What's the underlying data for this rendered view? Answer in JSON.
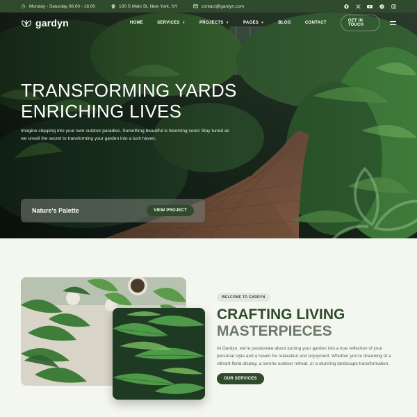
{
  "topbar": {
    "hours": "Monday - Saturday 08.00 - 18.00",
    "address": "100 S Main St, New York, NY",
    "email": "contact@gardyn.com",
    "social_icons": [
      "facebook-icon",
      "x-icon",
      "youtube-icon",
      "pinterest-icon",
      "instagram-icon"
    ]
  },
  "nav": {
    "logo_text": "gardyn",
    "items": [
      {
        "label": "HOME",
        "has_dropdown": false
      },
      {
        "label": "SERVICES",
        "has_dropdown": true
      },
      {
        "label": "PROJECTS",
        "has_dropdown": true
      },
      {
        "label": "PAGES",
        "has_dropdown": true
      },
      {
        "label": "BLOG",
        "has_dropdown": false
      },
      {
        "label": "CONTACT",
        "has_dropdown": false
      }
    ],
    "cta_label": "GET IN TOUCH"
  },
  "hero": {
    "title_line1": "TRANSFORMING YARDS",
    "title_line2": "ENRICHING LIVES",
    "description": "Imagine stepping into your own outdoor paradise. Something beautiful is blooming soon! Stay tuned as we unveil the secret to transforming your garden into a lush haven.",
    "project_name": "Nature's Palette",
    "project_button": "VIEW PROJECT"
  },
  "about": {
    "badge": "WELCOME TO GARDYN",
    "title_line1": "CRAFTING LIVING",
    "title_line2": "MASTERPIECES",
    "text": "At Gardyn, we're passionate about turning your garden into a true reflection of your personal style and a haven for relaxation and enjoyment. Whether you're dreaming of a vibrant floral display, a serene outdoor retreat, or a stunning landscape transformation.",
    "button": "OUR SERVICES"
  },
  "colors": {
    "brand_dark_green": "#2f4a2c",
    "page_background": "#f4f7ef",
    "muted_green": "#6b7a66"
  }
}
